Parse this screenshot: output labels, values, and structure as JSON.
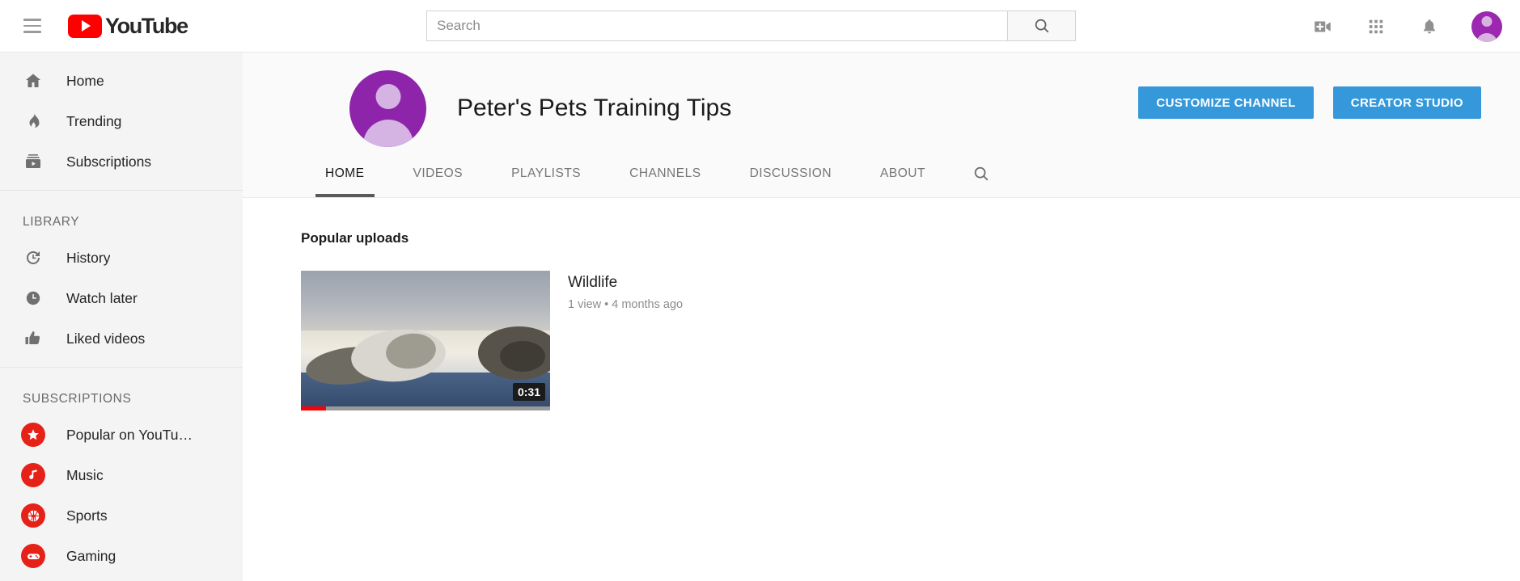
{
  "masthead": {
    "menu_icon": "hamburger-icon",
    "logo_text": "YouTube",
    "search": {
      "placeholder": "Search",
      "value": "",
      "button_icon": "search-icon"
    },
    "icons": [
      {
        "name": "create-video-icon",
        "label": "Create video"
      },
      {
        "name": "apps-grid-icon",
        "label": "YouTube apps"
      },
      {
        "name": "notifications-bell-icon",
        "label": "Notifications"
      }
    ],
    "account_avatar": "account-avatar"
  },
  "sidebar": {
    "primary": [
      {
        "label": "Home",
        "icon": "home-icon"
      },
      {
        "label": "Trending",
        "icon": "trending-flame-icon"
      },
      {
        "label": "Subscriptions",
        "icon": "subscriptions-icon"
      }
    ],
    "library_title": "LIBRARY",
    "library": [
      {
        "label": "History",
        "icon": "history-icon"
      },
      {
        "label": "Watch later",
        "icon": "clock-icon"
      },
      {
        "label": "Liked videos",
        "icon": "thumbs-up-icon"
      }
    ],
    "subscriptions_title": "SUBSCRIPTIONS",
    "subscriptions": [
      {
        "label": "Popular on YouTu…",
        "icon": "star-icon",
        "color": "#e62117"
      },
      {
        "label": "Music",
        "icon": "music-note-icon",
        "color": "#e62117"
      },
      {
        "label": "Sports",
        "icon": "basketball-icon",
        "color": "#e62117"
      },
      {
        "label": "Gaming",
        "icon": "gamepad-icon",
        "color": "#e62117"
      }
    ]
  },
  "channel": {
    "name": "Peter's Pets Training Tips",
    "avatar": "channel-avatar",
    "buttons": [
      {
        "label": "CUSTOMIZE CHANNEL",
        "name": "customize-channel-button"
      },
      {
        "label": "CREATOR STUDIO",
        "name": "creator-studio-button"
      }
    ],
    "accent_color": "#3498db",
    "tabs": [
      {
        "label": "HOME",
        "active": true
      },
      {
        "label": "VIDEOS",
        "active": false
      },
      {
        "label": "PLAYLISTS",
        "active": false
      },
      {
        "label": "CHANNELS",
        "active": false
      },
      {
        "label": "DISCUSSION",
        "active": false
      },
      {
        "label": "ABOUT",
        "active": false
      }
    ],
    "tab_search_icon": "search-icon"
  },
  "shelf": {
    "title": "Popular uploads",
    "videos": [
      {
        "title": "Wildlife",
        "meta": "1 view • 4 months ago",
        "duration": "0:31",
        "progress_percent": 10
      }
    ]
  }
}
